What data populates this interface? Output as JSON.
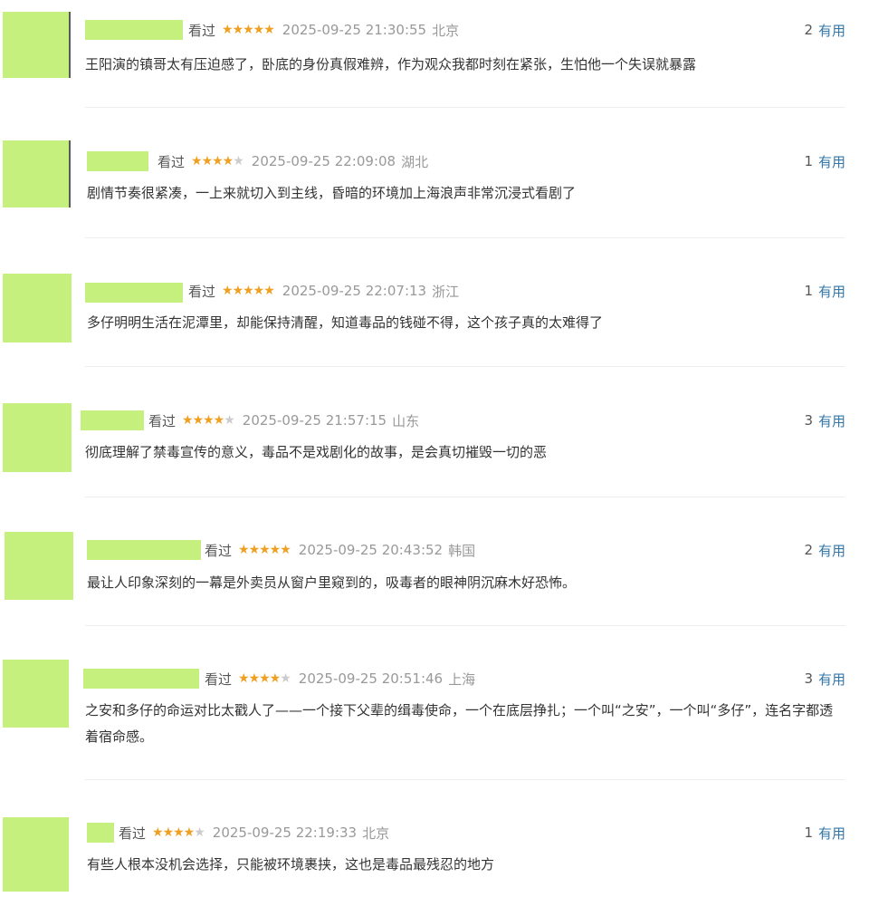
{
  "comments": [
    {
      "watched_label": "看过",
      "stars": "★★★★★",
      "stars_off": "",
      "time": "2025-09-25 21:30:55",
      "location": "北京",
      "useful_count": "2",
      "useful_label": "有用",
      "text": "王阳演的镇哥太有压迫感了，卧底的身份真假难辨，作为观众我都时刻在紧张，生怕他一个失误就暴露"
    },
    {
      "watched_label": "看过",
      "stars": "★★★★",
      "stars_off": "★",
      "time": "2025-09-25 22:09:08",
      "location": "湖北",
      "useful_count": "1",
      "useful_label": "有用",
      "text": "剧情节奏很紧凑，一上来就切入到主线，昏暗的环境加上海浪声非常沉浸式看剧了"
    },
    {
      "watched_label": "看过",
      "stars": "★★★★★",
      "stars_off": "",
      "time": "2025-09-25 22:07:13",
      "location": "浙江",
      "useful_count": "1",
      "useful_label": "有用",
      "text": "多仔明明生活在泥潭里，却能保持清醒，知道毒品的钱碰不得，这个孩子真的太难得了"
    },
    {
      "watched_label": "看过",
      "stars": "★★★★",
      "stars_off": "★",
      "time": "2025-09-25 21:57:15",
      "location": "山东",
      "useful_count": "3",
      "useful_label": "有用",
      "text": "彻底理解了禁毒宣传的意义，毒品不是戏剧化的故事，是会真切摧毁一切的恶"
    },
    {
      "watched_label": "看过",
      "stars": "★★★★★",
      "stars_off": "",
      "time": "2025-09-25 20:43:52",
      "location": "韩国",
      "useful_count": "2",
      "useful_label": "有用",
      "text": "最让人印象深刻的一幕是外卖员从窗户里窥到的，吸毒者的眼神阴沉麻木好恐怖。"
    },
    {
      "watched_label": "看过",
      "stars": "★★★★",
      "stars_off": "★",
      "time": "2025-09-25 20:51:46",
      "location": "上海",
      "useful_count": "3",
      "useful_label": "有用",
      "text": "之安和多仔的命运对比太戳人了——一个接下父辈的缉毒使命，一个在底层挣扎；一个叫“之安”，一个叫“多仔”，连名字都透着宿命感。"
    },
    {
      "watched_label": "看过",
      "stars": "★★★★",
      "stars_off": "★",
      "time": "2025-09-25 22:19:33",
      "location": "北京",
      "useful_count": "1",
      "useful_label": "有用",
      "text": "有些人根本没机会选择，只能被环境裹挟，这也是毒品最残忍的地方"
    }
  ]
}
